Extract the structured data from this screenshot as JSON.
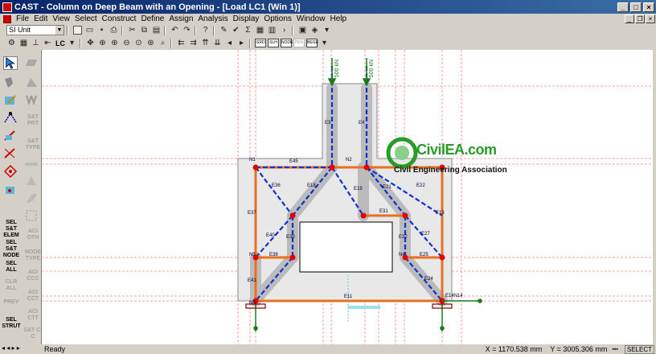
{
  "window": {
    "title": "CAST - Column on Deep Beam with an Opening - [Load LC1 (Win 1)]"
  },
  "menu": [
    "File",
    "Edit",
    "View",
    "Select",
    "Construct",
    "Define",
    "Assign",
    "Analysis",
    "Display",
    "Options",
    "Window",
    "Help"
  ],
  "toolbar": {
    "unit_system": "SI Unit",
    "load_case": "LC",
    "view_buttons": [
      "GRD",
      "SLH",
      "NODE",
      "PEN",
      "BEGE"
    ]
  },
  "palette": {
    "buttons": [
      "S&T PRT",
      "S&T TYPE",
      "SEL S&T ELEM",
      "SEL S&T NODE",
      "SEL ALL",
      "CLR ALL",
      "PREV",
      "SEL STRUT",
      "ACI OTH",
      "NODE TYPE",
      "ACI CCC",
      "ACI CCT",
      "ACI CTT",
      "S&T C-C"
    ]
  },
  "loads": [
    "500 kN",
    "500 kN"
  ],
  "elements": {
    "top": "E45",
    "left_col": "E3",
    "right_col": "E4",
    "e18": "E18",
    "e19": "E19",
    "e21": "E21",
    "e22": "E22",
    "e31": "E31",
    "e37": "E37",
    "e13": "E13",
    "e40": "E40",
    "e39": "E39",
    "e38": "E38",
    "e32": "E32",
    "e27": "E27",
    "e25": "E25",
    "e41": "E41",
    "e24": "E24",
    "e11": "E11",
    "e14n14": "E14N14",
    "e36": "E36"
  },
  "nodes": [
    "N1",
    "N2",
    "N3",
    "N4",
    "N5",
    "N6",
    "N7",
    "N8",
    "N9",
    "N10",
    "N11",
    "N12",
    "N13",
    "N14"
  ],
  "watermark": {
    "name": "CivilEA.com",
    "tagline": "Civil Engineering Association"
  },
  "status": {
    "text": "Ready",
    "x": "X = 1170.538 mm",
    "y": "Y = 3005.306 mm",
    "mode": "SELECT"
  }
}
